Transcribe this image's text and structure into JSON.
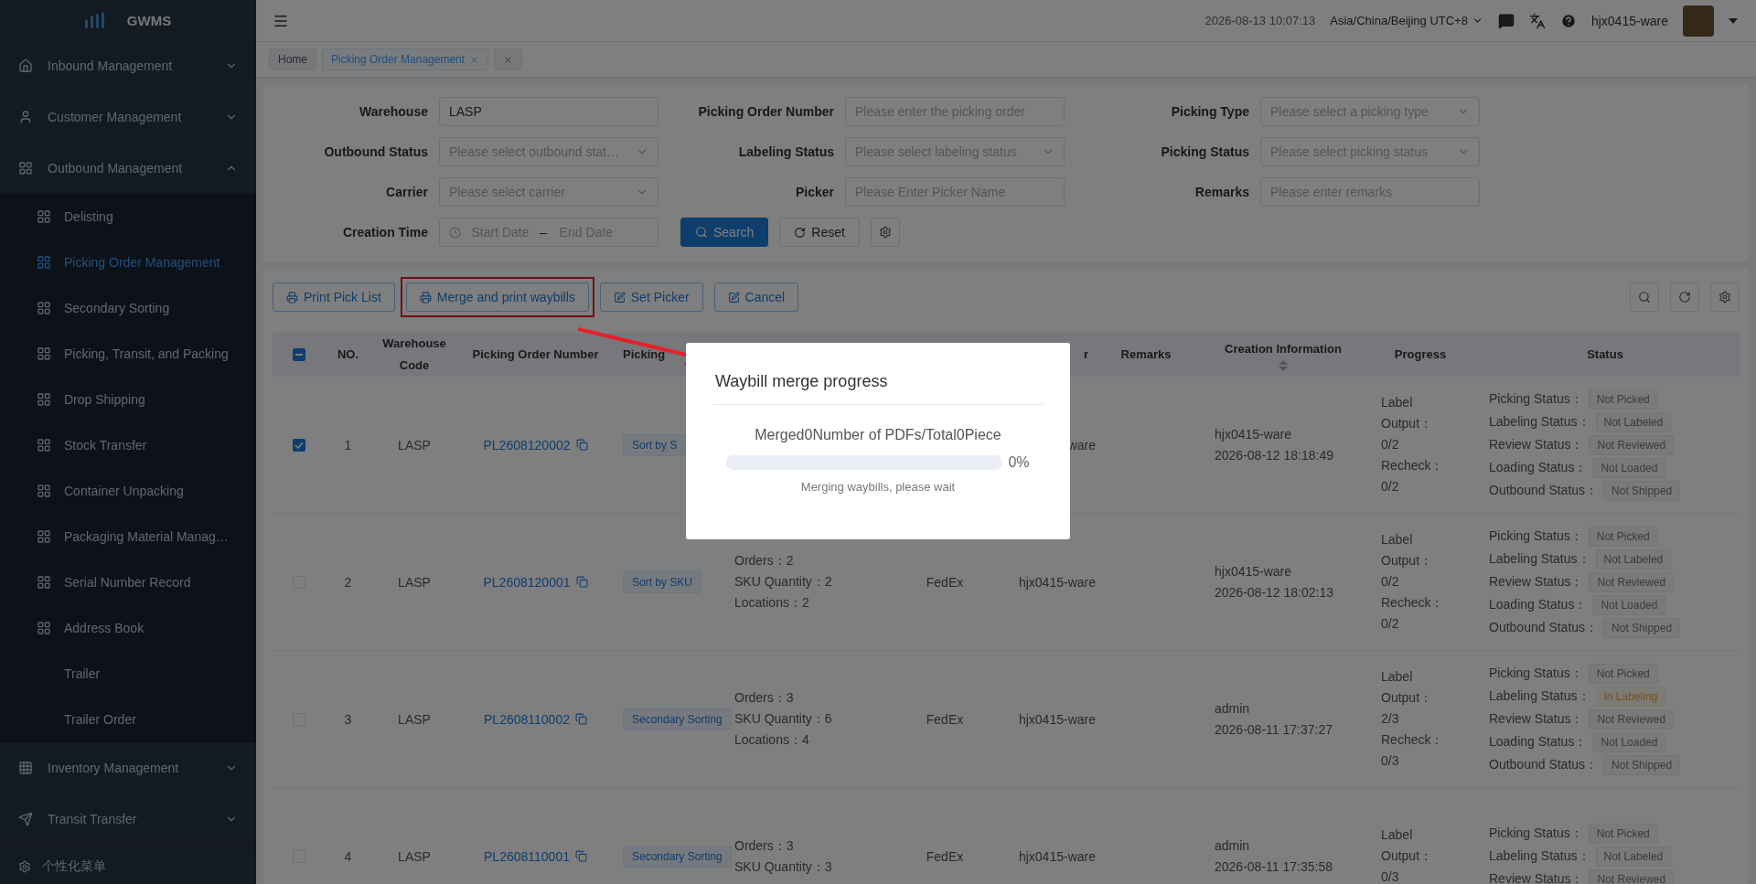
{
  "sidebar": {
    "logo": "GWMS",
    "items": [
      {
        "label": "Inbound Management",
        "expanded": false
      },
      {
        "label": "Customer Management",
        "expanded": false
      },
      {
        "label": "Outbound Management",
        "expanded": true,
        "children": [
          {
            "label": "Delisting",
            "kind": "grid",
            "selected": false
          },
          {
            "label": "Picking Order Management",
            "kind": "grid",
            "selected": true
          },
          {
            "label": "Secondary Sorting",
            "kind": "grid",
            "selected": false
          },
          {
            "label": "Picking, Transit, and Packing",
            "kind": "grid",
            "selected": false
          },
          {
            "label": "Drop Shipping",
            "kind": "grid",
            "selected": false
          },
          {
            "label": "Stock Transfer",
            "kind": "grid",
            "selected": false
          },
          {
            "label": "Container Unpacking",
            "kind": "grid",
            "selected": false
          },
          {
            "label": "Packaging Material Manag…",
            "kind": "grid",
            "selected": false
          },
          {
            "label": "Serial Number Record",
            "kind": "grid",
            "selected": false
          },
          {
            "label": "Address Book",
            "kind": "grid",
            "selected": false
          },
          {
            "label": "Trailer",
            "kind": "plain",
            "selected": false
          },
          {
            "label": "Trailer Order",
            "kind": "plain",
            "selected": false
          }
        ]
      },
      {
        "label": "Inventory Management",
        "expanded": false
      },
      {
        "label": "Transit Transfer",
        "expanded": false
      }
    ],
    "footer": "个性化菜单"
  },
  "header": {
    "datetime": "2026-08-13 10:07:13",
    "timezone": "Asia/China/Beijing UTC+8",
    "username": "hjx0415-ware"
  },
  "tabs": [
    {
      "label": "Home",
      "selected": false,
      "closable": false
    },
    {
      "label": "Picking Order Management",
      "selected": true,
      "closable": true
    },
    {
      "selected": false,
      "closable": true
    }
  ],
  "filters": [
    {
      "label": "Warehouse",
      "kind": "input",
      "value": "LASP"
    },
    {
      "label": "Picking Order Number",
      "kind": "input",
      "placeholder": "Please enter the picking order"
    },
    {
      "label": "Picking Type",
      "kind": "select",
      "placeholder": "Please select a picking type"
    },
    {
      "label": "Outbound Status",
      "kind": "select",
      "placeholder": "Please select outbound stat…"
    },
    {
      "label": "Labeling Status",
      "kind": "select",
      "placeholder": "Please select labeling status"
    },
    {
      "label": "Picking Status",
      "kind": "select",
      "placeholder": "Please select picking status"
    },
    {
      "label": "Carrier",
      "kind": "select",
      "placeholder": "Please select carrier"
    },
    {
      "label": "Picker",
      "kind": "input",
      "placeholder": "Please Enter Picker Name"
    },
    {
      "label": "Remarks",
      "kind": "input",
      "placeholder": "Please enter remarks"
    },
    {
      "label": "Creation Time",
      "kind": "daterange",
      "start_placeholder": "Start Date",
      "separator": "–",
      "end_placeholder": "End Date"
    }
  ],
  "filter_buttons": {
    "search": "Search",
    "reset": "Reset"
  },
  "toolbar": [
    {
      "label": "Print Pick List",
      "highlighted": false
    },
    {
      "label": "Merge and print waybills",
      "highlighted": true
    },
    {
      "label": "Set Picker",
      "highlighted": false
    },
    {
      "label": "Cancel",
      "highlighted": false
    }
  ],
  "table": {
    "select_all_indeterminate": true,
    "columns": [
      {
        "label": "NO."
      },
      {
        "label": "Warehouse Code"
      },
      {
        "label": "Picking Order Number"
      },
      {
        "label": "Picking"
      },
      {
        "label": "r"
      },
      {
        "label": "Remarks"
      },
      {
        "label": "Creation Information",
        "sortable": true
      },
      {
        "label": "Progress"
      },
      {
        "label": "Status"
      }
    ],
    "rows": [
      {
        "checked": true,
        "no": "1",
        "warehouse": "LASP",
        "order_number": "PL2608120002",
        "picking_type": "Sort by S",
        "info": [],
        "picker": "ware",
        "creator": "hjx0415-ware",
        "created": "2026-08-12 18:18:49",
        "progress": [
          "Label Output：",
          "0/2",
          "Recheck：",
          "0/2"
        ],
        "statuses": [
          {
            "label": "Picking Status：",
            "value": "Not Picked",
            "warning": false
          },
          {
            "label": "Labeling Status：",
            "value": "Not Labeled",
            "warning": false
          },
          {
            "label": "Review Status：",
            "value": "Not Reviewed",
            "warning": false
          },
          {
            "label": "Loading Status：",
            "value": "Not Loaded",
            "warning": false
          },
          {
            "label": "Outbound Status：",
            "value": "Not Shipped",
            "warning": false
          }
        ]
      },
      {
        "checked": false,
        "no": "2",
        "warehouse": "LASP",
        "order_number": "PL2608120001",
        "picking_type": "Sort by SKU",
        "info": [
          "Orders：2",
          "SKU Quantity：2",
          "Locations：2"
        ],
        "carrier": "FedEx",
        "picker": "hjx0415-ware",
        "creator": "hjx0415-ware",
        "created": "2026-08-12 18:02:13",
        "progress": [
          "Label Output：",
          "0/2",
          "Recheck：",
          "0/2"
        ],
        "statuses": [
          {
            "label": "Picking Status：",
            "value": "Not Picked",
            "warning": false
          },
          {
            "label": "Labeling Status：",
            "value": "Not Labeled",
            "warning": false
          },
          {
            "label": "Review Status：",
            "value": "Not Reviewed",
            "warning": false
          },
          {
            "label": "Loading Status：",
            "value": "Not Loaded",
            "warning": false
          },
          {
            "label": "Outbound Status：",
            "value": "Not Shipped",
            "warning": false
          }
        ]
      },
      {
        "checked": false,
        "no": "3",
        "warehouse": "LASP",
        "order_number": "PL2608110002",
        "picking_type": "Secondary Sorting",
        "info": [
          "Orders：3",
          "SKU Quantity：6",
          "Locations：4"
        ],
        "carrier": "FedEx",
        "picker": "hjx0415-ware",
        "creator": "admin",
        "created": "2026-08-11 17:37:27",
        "progress": [
          "Label Output：",
          "2/3",
          "Recheck：",
          "0/3"
        ],
        "statuses": [
          {
            "label": "Picking Status：",
            "value": "Not Picked",
            "warning": false
          },
          {
            "label": "Labeling Status：",
            "value": "In Labeling",
            "warning": true
          },
          {
            "label": "Review Status：",
            "value": "Not Reviewed",
            "warning": false
          },
          {
            "label": "Loading Status：",
            "value": "Not Loaded",
            "warning": false
          },
          {
            "label": "Outbound Status：",
            "value": "Not Shipped",
            "warning": false
          }
        ]
      },
      {
        "checked": false,
        "no": "4",
        "warehouse": "LASP",
        "order_number": "PL2608110001",
        "picking_type": "Secondary Sorting",
        "info": [
          "Orders：3",
          "SKU Quantity：3"
        ],
        "carrier": "FedEx",
        "picker": "hjx0415-ware",
        "creator": "admin",
        "created": "2026-08-11 17:35:58",
        "progress": [
          "Label Output：",
          "0/3"
        ],
        "statuses": [
          {
            "label": "Picking Status：",
            "value": "Not Picked",
            "warning": false
          },
          {
            "label": "Labeling Status：",
            "value": "Not Labeled",
            "warning": false
          },
          {
            "label": "Review Status：",
            "value": "Not Reviewed",
            "warning": false
          }
        ]
      }
    ]
  },
  "modal": {
    "title": "Waybill merge progress",
    "summary": "Merged0Number of PDFs/Total0Piece",
    "level": 0,
    "percent": "0%",
    "note": "Merging waybills, please wait"
  }
}
